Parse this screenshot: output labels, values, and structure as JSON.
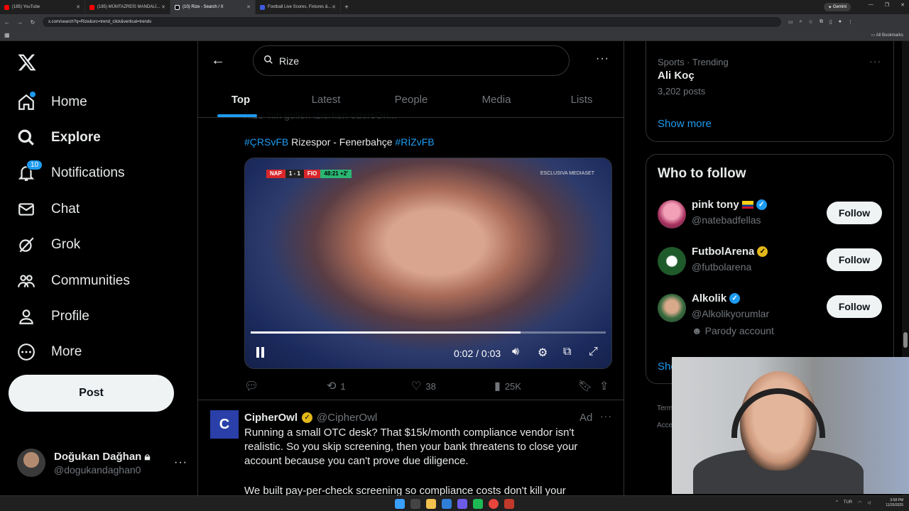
{
  "browser": {
    "tabs": [
      {
        "title": "(185) YouTube",
        "color": "#ff0000"
      },
      {
        "title": "(185) MÜMTAZREİS MANDALİ...",
        "color": "#ff0000"
      },
      {
        "title": "(10) Rize - Search / X",
        "color": "#ffffff"
      },
      {
        "title": "Football Live Scores, Fixtures &...",
        "color": "#3b5bdb"
      }
    ],
    "gemini_label": "Gemini",
    "url": "x.com/search?q=Rize&src=trend_click&vertical=trends",
    "all_bookmarks": "All Bookmarks"
  },
  "sidebar": {
    "logo": "X",
    "items": [
      {
        "label": "Home",
        "icon": "home-icon"
      },
      {
        "label": "Explore",
        "icon": "search-icon"
      },
      {
        "label": "Notifications",
        "icon": "bell-icon",
        "badge": "10"
      },
      {
        "label": "Chat",
        "icon": "mail-icon"
      },
      {
        "label": "Grok",
        "icon": "grok-icon"
      },
      {
        "label": "Communities",
        "icon": "communities-icon"
      },
      {
        "label": "Profile",
        "icon": "person-icon"
      },
      {
        "label": "More",
        "icon": "more-circle-icon"
      }
    ],
    "post_label": "Post",
    "account": {
      "name": "Doğukan Dağhan",
      "handle": "@dogukandaghan0"
    }
  },
  "search": {
    "query": "Rize",
    "tabs": [
      "Top",
      "Latest",
      "People",
      "Media",
      "Lists"
    ],
    "active_tab": "Top"
  },
  "tweet": {
    "faded_text": "Rize  'nin gollen izlerken edersOn...",
    "text_pre_hashtag": "#ÇRSvFB",
    "text_middle": " Rizespor - Fenerbahçe ",
    "text_post_hashtag": "#RİZvFB",
    "video": {
      "score_home": "NAP",
      "score": "1 - 1",
      "score_away": "FIO",
      "clock": "48:21 +2'",
      "broadcaster": "ESCLUSIVA MEDIASET",
      "time": "0:02 / 0:03",
      "progress": 0.76
    },
    "stats": {
      "replies": "",
      "reposts": "1",
      "likes": "38",
      "views": "25K"
    }
  },
  "ad": {
    "name": "CipherOwl",
    "handle": "@CipherOwl",
    "tag": "Ad",
    "body": "Running a small OTC desk? That $15k/month compliance vendor isn't realistic. So you skip screening, then your bank threatens to close your account because you can't prove due diligence.",
    "body2": "We built pay-per-check screening so compliance costs don't kill your business."
  },
  "trending": {
    "category": "Sports · Trending",
    "name": "Ali Koç",
    "count": "3,202 posts",
    "show_more": "Show more"
  },
  "who_to_follow": {
    "title": "Who to follow",
    "follow_label": "Follow",
    "users": [
      {
        "name": "pink tony",
        "handle": "@natebadfellas",
        "verified": "blue",
        "extra": ""
      },
      {
        "name": "FutbolArena",
        "handle": "@futbolarena",
        "verified": "gold",
        "extra": ""
      },
      {
        "name": "Alkolik",
        "handle": "@Alkolikyorumlar",
        "verified": "blue",
        "extra": "Parody account"
      }
    ],
    "show_more": "Show more"
  },
  "footer_links": {
    "line1": "Term",
    "line2": "Acce"
  },
  "taskbar": {
    "lang": "TUR",
    "time": "3:58 PM",
    "date": "11/25/2025"
  }
}
